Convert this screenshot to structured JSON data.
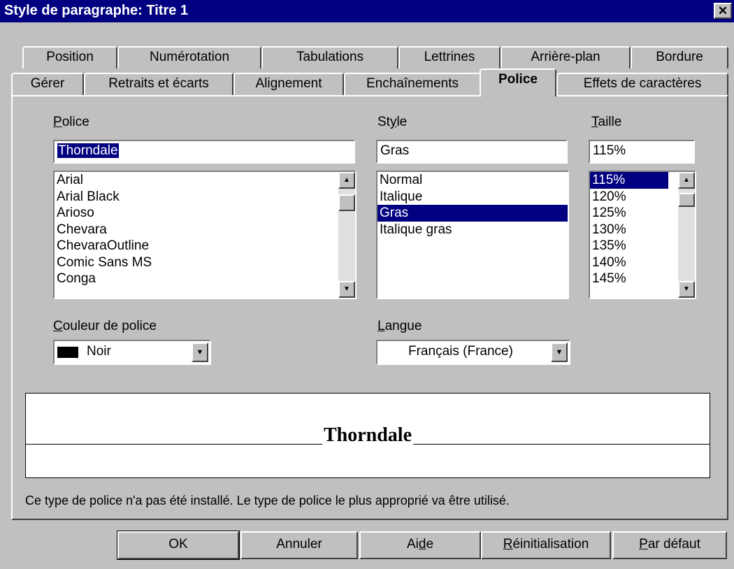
{
  "window": {
    "title": "Style de paragraphe: Titre 1",
    "close_glyph": "✕"
  },
  "tabs_row1": [
    "Position",
    "Numérotation",
    "Tabulations",
    "Lettrines",
    "Arrière-plan",
    "Bordure"
  ],
  "tabs_row2": [
    "Gérer",
    "Retraits et écarts",
    "Alignement",
    "Enchaînements",
    "Police",
    "Effets de caractères"
  ],
  "active_tab": "Police",
  "police": {
    "font": {
      "label_u": "P",
      "label_rest": "olice",
      "value": "Thorndale",
      "items": [
        "Arial",
        "Arial Black",
        "Arioso",
        "Chevara",
        "ChevaraOutline",
        "Comic Sans MS",
        "Conga"
      ]
    },
    "style": {
      "label_pre": "St",
      "label_u": "y",
      "label_rest": "le",
      "value": "Gras",
      "items": [
        "Normal",
        "Italique",
        "Gras",
        "Italique gras"
      ],
      "selected": "Gras"
    },
    "size": {
      "label_u": "T",
      "label_rest": "aille",
      "value": "115%",
      "items": [
        "115%",
        "120%",
        "125%",
        "130%",
        "135%",
        "140%",
        "145%"
      ],
      "selected": "115%"
    },
    "color": {
      "label_u": "C",
      "label_rest": "ouleur de police",
      "value": "Noir",
      "swatch": "#000000"
    },
    "language": {
      "label_u": "L",
      "label_rest": "angue",
      "value": "Français (France)"
    },
    "preview_text": "Thorndale",
    "info": "Ce type de police n'a pas été installé. Le type de police le plus approprié va être utilisé."
  },
  "buttons": {
    "ok": "OK",
    "cancel": "Annuler",
    "help_pre": "Ai",
    "help_u": "d",
    "help_rest": "e",
    "reset_u": "R",
    "reset_rest": "éinitialisation",
    "default_u": "P",
    "default_rest": "ar défaut"
  },
  "icons": {
    "scroll_up": "▲",
    "scroll_down": "▼",
    "dropdown": "▼"
  },
  "colors": {
    "titlebar": "#000080",
    "face": "#c0c0c0",
    "selection": "#000080"
  }
}
